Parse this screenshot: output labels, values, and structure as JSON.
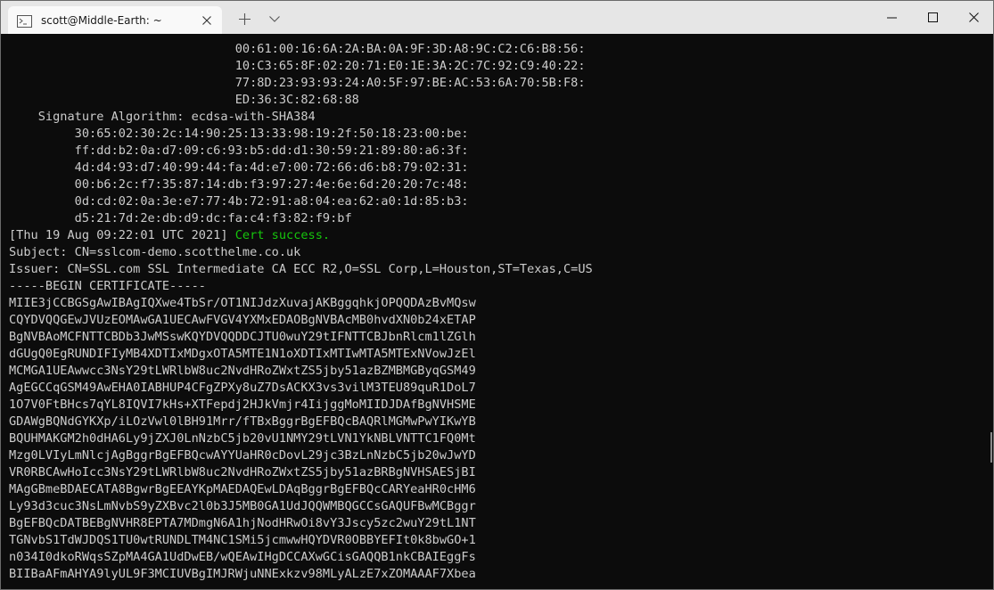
{
  "window": {
    "tab_title": "scott@Middle-Earth: ~"
  },
  "terminal": {
    "lines_top": [
      "                               00:61:00:16:6A:2A:BA:0A:9F:3D:A8:9C:C2:C6:B8:56:",
      "                               10:C3:65:8F:02:20:71:E0:1E:3A:2C:7C:92:C9:40:22:",
      "                               77:8D:23:93:93:24:A0:5F:97:BE:AC:53:6A:70:5B:F8:",
      "                               ED:36:3C:82:68:88",
      "    Signature Algorithm: ecdsa-with-SHA384",
      "         30:65:02:30:2c:14:90:25:13:33:98:19:2f:50:18:23:00:be:",
      "         ff:dd:b2:0a:d7:09:c6:93:b5:dd:d1:30:59:21:89:80:a6:3f:",
      "         4d:d4:93:d7:40:99:44:fa:4d:e7:00:72:66:d6:b8:79:02:31:",
      "         00:b6:2c:f7:35:87:14:db:f3:97:27:4e:6e:6d:20:20:7c:48:",
      "         0d:cd:02:0a:3e:e7:77:4b:72:91:a8:04:ea:62:a0:1d:85:b3:",
      "         d5:21:7d:2e:db:d9:dc:fa:c4:f3:82:f9:bf"
    ],
    "status_prefix": "[Thu 19 Aug 09:22:01 UTC 2021] ",
    "status_success": "Cert success.",
    "lines_bottom": [
      "Subject: CN=sslcom-demo.scotthelme.co.uk",
      "Issuer: CN=SSL.com SSL Intermediate CA ECC R2,O=SSL Corp,L=Houston,ST=Texas,C=US",
      "-----BEGIN CERTIFICATE-----",
      "MIIE3jCCBGSgAwIBAgIQXwe4TbSr/OT1NIJdzXuvajAKBggqhkjOPQQDAzBvMQsw",
      "CQYDVQQGEwJVUzEOMAwGA1UECAwFVGV4YXMxEDAOBgNVBAcMB0hvdXN0b24xETAP",
      "BgNVBAoMCFNTTCBDb3JwMSswKQYDVQQDDCJTU0wuY29tIFNTTCBJbnRlcm1lZGlh",
      "dGUgQ0EgRUNDIFIyMB4XDTIxMDgxOTA5MTE1N1oXDTIxMTIwMTA5MTExNVowJzEl",
      "MCMGA1UEAwwcc3NsY29tLWRlbW8uc2NvdHRoZWxtZS5jby51azBZMBMGByqGSM49",
      "AgEGCCqGSM49AwEHA0IABHUP4CFgZPXy8uZ7DsACKX3vs3vilM3TEU89quR1DoL7",
      "1O7V0FtBHcs7qYL8IQVI7kHs+XTFepdj2HJkVmjr4IijggMoMIIDJDAfBgNVHSME",
      "GDAWgBQNdGYKXp/iLOzVwl0lBH91Mrr/fTBxBggrBgEFBQcBAQRlMGMwPwYIKwYB",
      "BQUHMAKGM2h0dHA6Ly9jZXJ0LnNzbC5jb20vU1NMY29tLVN1YkNBLVNTTC1FQ0Mt",
      "Mzg0LVIyLmNlcjAgBggrBgEFBQcwAYYUaHR0cDovL29jc3BzLnNzbC5jb20wJwYD",
      "VR0RBCAwHoIcc3NsY29tLWRlbW8uc2NvdHRoZWxtZS5jby51azBRBgNVHSAESjBI",
      "MAgGBmeBDAECATA8BgwrBgEEAYKpMAEDAQEwLDAqBggrBgEFBQcCARYeaHR0cHM6",
      "Ly93d3cuc3NsLmNvbS9yZXBvc2l0b3J5MB0GA1UdJQQWMBQGCCsGAQUFBwMCBggr",
      "BgEFBQcDATBEBgNVHR8EPTA7MDmgN6A1hjNodHRwOi8vY3Jscy5zc2wuY29tL1NT",
      "TGNvbS1TdWJDQS1TU0wtRUNDLTM4NC1SMi5jcmwwHQYDVR0OBBYEFIt0k8bwGO+1",
      "n034I0dkoRWqsSZpMA4GA1UdDwEB/wQEAwIHgDCCAXwGCisGAQQB1nkCBAIEggFs",
      "BIIBaAFmAHYA9lyUL9F3MCIUVBgIMJRWjuNNExkzv98MLyALzE7xZOMAAAF7Xbea"
    ]
  }
}
